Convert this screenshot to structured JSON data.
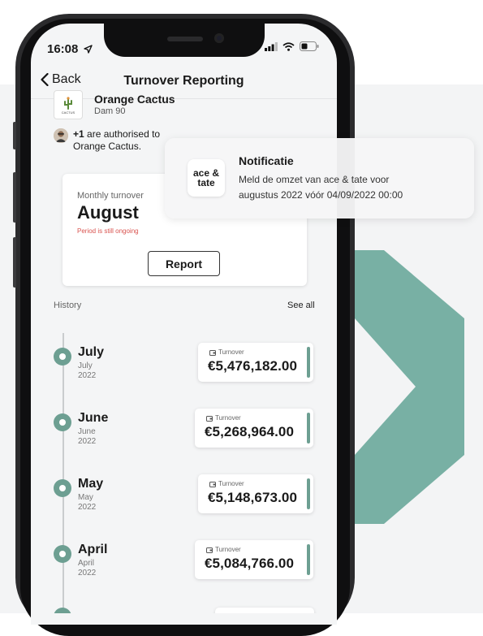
{
  "status": {
    "time": "16:08"
  },
  "nav": {
    "back_label": "Back",
    "title": "Turnover Reporting"
  },
  "store": {
    "name": "Orange Cactus",
    "address": "Dam 90",
    "logo_text": "CACTUS"
  },
  "authorised": {
    "count": "+1",
    "line1_suffix": " are authorised to",
    "line2": "Orange Cactus."
  },
  "monthly": {
    "label": "Monthly turnover",
    "month": "August",
    "warning": "Period is still ongoing",
    "report_label": "Report"
  },
  "history": {
    "label": "History",
    "see_all": "See all",
    "items": [
      {
        "month": "July",
        "sub": "July",
        "year": "2022",
        "turnover_label": "Turnover",
        "amount": "€5,476,182.00"
      },
      {
        "month": "June",
        "sub": "June",
        "year": "2022",
        "turnover_label": "Turnover",
        "amount": "€5,268,964.00"
      },
      {
        "month": "May",
        "sub": "May",
        "year": "2022",
        "turnover_label": "Turnover",
        "amount": "€5,148,673.00"
      },
      {
        "month": "April",
        "sub": "April",
        "year": "2022",
        "turnover_label": "Turnover",
        "amount": "€5,084,766.00"
      }
    ]
  },
  "notification": {
    "app_line1": "ace &",
    "app_line2": "tate",
    "title": "Notificatie",
    "line1": "Meld de omzet van ace & tate voor",
    "line2": "augustus 2022 vóór 04/09/2022 00:00"
  },
  "colors": {
    "accent": "#6d9f92",
    "chevron": "#78b0a4",
    "warning": "#d9534f"
  }
}
